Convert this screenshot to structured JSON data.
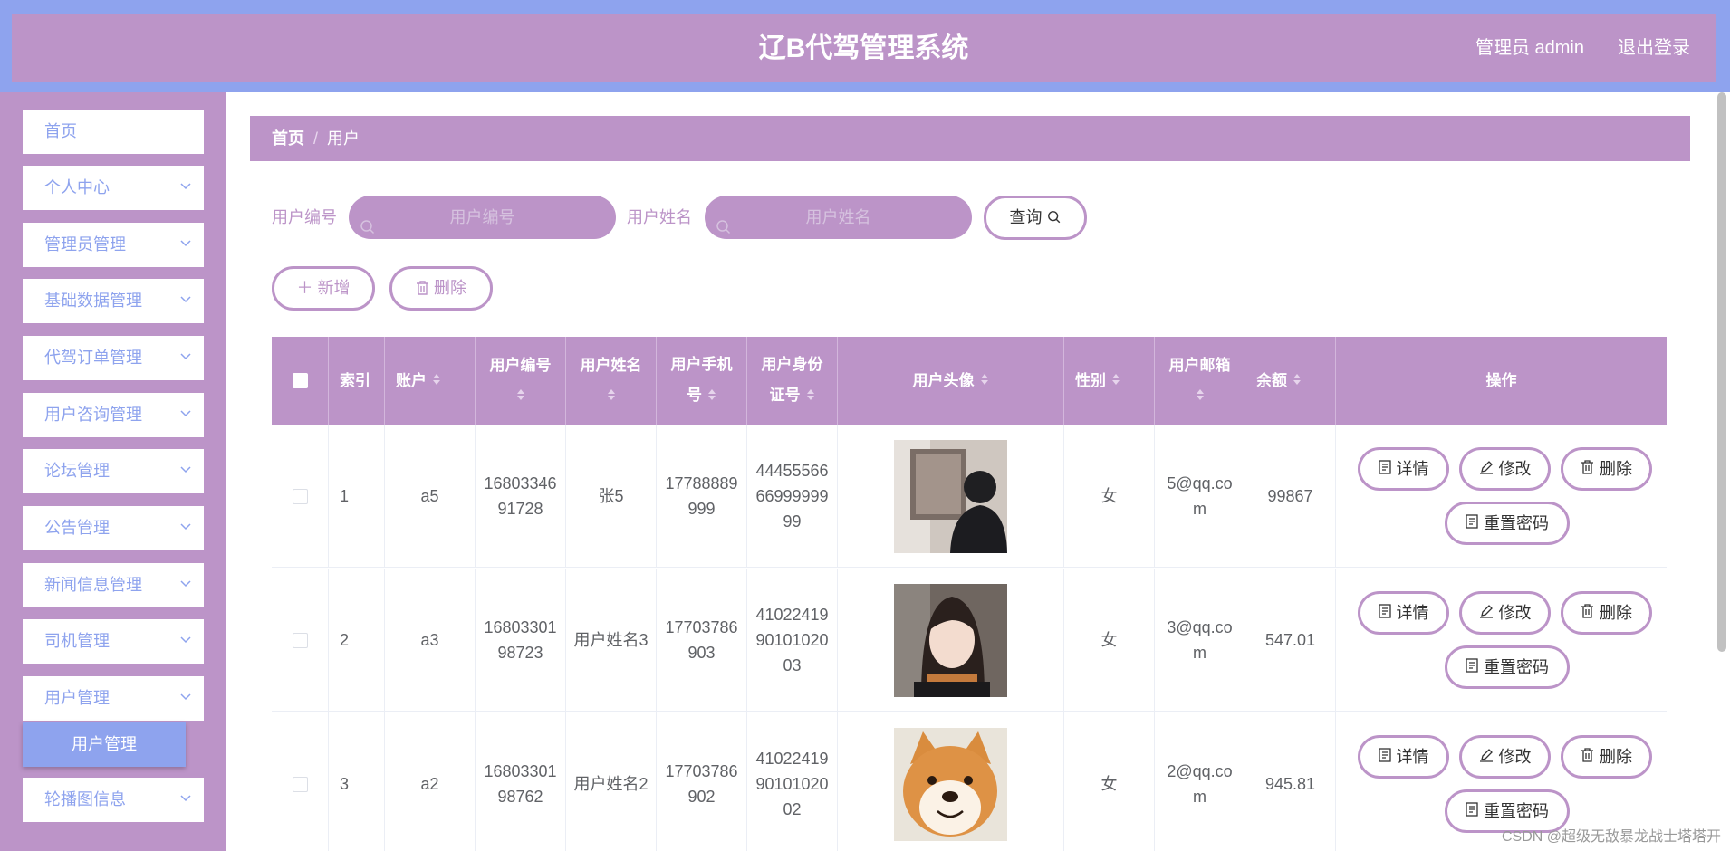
{
  "header": {
    "title": "辽B代驾管理系统",
    "user_label": "管理员 admin",
    "logout_label": "退出登录"
  },
  "sidebar": {
    "items": [
      {
        "label": "首页",
        "has_children": false
      },
      {
        "label": "个人中心",
        "has_children": true
      },
      {
        "label": "管理员管理",
        "has_children": true
      },
      {
        "label": "基础数据管理",
        "has_children": true
      },
      {
        "label": "代驾订单管理",
        "has_children": true
      },
      {
        "label": "用户咨询管理",
        "has_children": true
      },
      {
        "label": "论坛管理",
        "has_children": true
      },
      {
        "label": "公告管理",
        "has_children": true
      },
      {
        "label": "新闻信息管理",
        "has_children": true
      },
      {
        "label": "司机管理",
        "has_children": true
      },
      {
        "label": "用户管理",
        "has_children": true
      },
      {
        "label": "轮播图信息",
        "has_children": true
      }
    ],
    "active_sub_item": "用户管理"
  },
  "breadcrumb": {
    "home": "首页",
    "separator": "/",
    "current": "用户"
  },
  "search": {
    "user_no_label": "用户编号",
    "user_no_placeholder": "用户编号",
    "user_name_label": "用户姓名",
    "user_name_placeholder": "用户姓名",
    "query_label": "查询"
  },
  "actions": {
    "add_label": "新增",
    "delete_label": "删除"
  },
  "table": {
    "headers": {
      "index": "索引",
      "account": "账户",
      "user_no": "用户编号",
      "user_name": "用户姓名",
      "phone": "用户手机号",
      "id_card": "用户身份证号",
      "avatar": "用户头像",
      "gender": "性别",
      "email": "用户邮箱",
      "balance": "余额",
      "ops": "操作"
    },
    "rows": [
      {
        "index": "1",
        "account": "a5",
        "user_no": "1680334691728",
        "user_name": "张5",
        "phone": "17788889999",
        "id_card": "444555666699999999",
        "avatar": "avatar-photo-back-view",
        "gender": "女",
        "email": "5@qq.com",
        "balance": "99867"
      },
      {
        "index": "2",
        "account": "a3",
        "user_no": "1680330198723",
        "user_name": "用户姓名3",
        "phone": "17703786903",
        "id_card": "410224199010102003",
        "avatar": "avatar-photo-girl",
        "gender": "女",
        "email": "3@qq.com",
        "balance": "547.01"
      },
      {
        "index": "3",
        "account": "a2",
        "user_no": "1680330198762",
        "user_name": "用户姓名2",
        "phone": "17703786902",
        "id_card": "410224199010102002",
        "avatar": "avatar-photo-shiba-dog",
        "gender": "女",
        "email": "2@qq.com",
        "balance": "945.81"
      }
    ],
    "op_labels": {
      "detail": "详情",
      "edit": "修改",
      "delete": "删除",
      "reset_password": "重置密码"
    }
  },
  "watermark": "CSDN @超级无敌暴龙战士塔塔开",
  "colors": {
    "primary_purple": "#bc94c8",
    "accent_blue": "#8ea3ee"
  }
}
